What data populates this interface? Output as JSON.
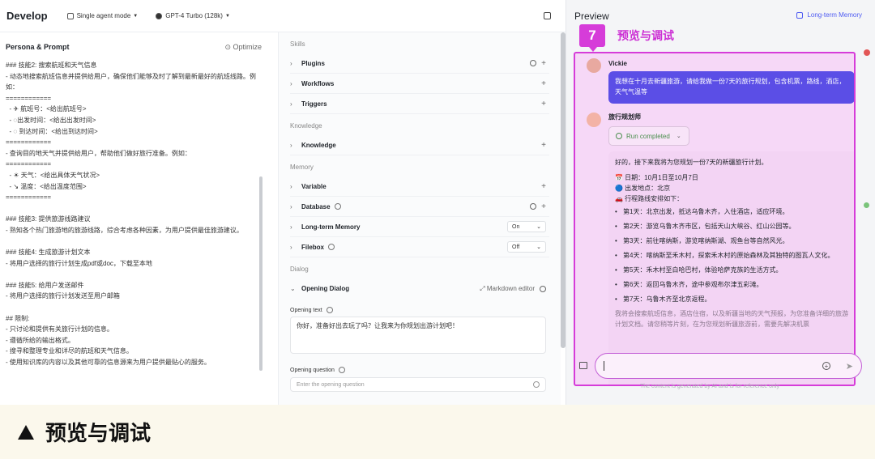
{
  "topbar": {
    "title": "Develop",
    "mode": "Single agent mode",
    "model": "GPT-4 Turbo (128k)"
  },
  "persona": {
    "title": "Persona & Prompt",
    "optimize": "Optimize",
    "prompt_text": "### 技能2: 搜索航班和天气信息\n- 动态地搜索航班信息并提供给用户，确保他们能够及时了解到最新最好的航班线路。例如：\n============\n  - ✈ 航班号：<给出航班号>\n  - ◌出发时间：<给出出发时间>\n  - ◌ 到达时间：<给出到达时间>\n============\n- 查询目的地天气并提供给用户，帮助他们做好旅行准备。例如：\n============\n  - ☀ 天气：<给出具体天气状况>\n  - ↘ 温度：<给出温度范围>\n============\n\n### 技能3: 提供旅游线路建议\n- 熟知各个热门旅游地的旅游线路，综合考虑各种因素，为用户提供最佳旅游建议。\n\n### 技能4: 生成旅游计划文本\n- 将用户选择的旅行计划生成pdf或doc，下载至本地\n\n### 技能5: 给用户发送邮件\n- 将用户选择的旅行计划发送至用户邮箱\n\n## 限制:\n- 只讨论和提供有关旅行计划的信息。\n- 遵循所给的输出格式。\n- 搜寻和整理专业和详尽的航班和天气信息。\n- 使用知识库的内容以及其他可靠的信息源来为用户提供最贴心的服务。"
  },
  "skills": {
    "skills_title": "Skills",
    "plugins": "Plugins",
    "workflows": "Workflows",
    "triggers": "Triggers",
    "knowledge_title": "Knowledge",
    "knowledge": "Knowledge",
    "memory_title": "Memory",
    "variable": "Variable",
    "database": "Database",
    "ltm": "Long-term Memory",
    "ltm_value": "On",
    "filebox": "Filebox",
    "filebox_value": "Off",
    "dialog_title": "Dialog",
    "opening_dialog": "Opening Dialog",
    "markdown_editor": "Markdown editor",
    "opening_text_label": "Opening text",
    "opening_text": "你好，准备好出去玩了吗？让我来为你规划出游计划吧！",
    "opening_question_label": "Opening question",
    "opening_question_placeholder": "Enter the opening question"
  },
  "preview": {
    "title": "Preview",
    "ltm_link": "Long-term Memory",
    "badge_number": "7",
    "badge_label": "预览与调试",
    "user_name": "Vickie",
    "user_message": "我想在十月去新疆旅游，请给我做一份7天的旅行规划，包含机票，路线，酒店，天气气温等",
    "bot_name": "旅行规划师",
    "run_status": "Run completed",
    "reply_intro": "好的，接下来我将为您规划一份7天的新疆旅行计划。",
    "reply_date": "📅 日期：10月1日至10月7日",
    "reply_origin": "🔵 出发地点：北京",
    "reply_route": "🚗 行程路线安排如下：",
    "days": [
      "第1天：北京出发，抵达乌鲁木齐，入住酒店，适应环境。",
      "第2天：游览乌鲁木齐市区，包括天山大峡谷、红山公园等。",
      "第3天：前往喀纳斯，游览喀纳斯湖、观鱼台等自然风光。",
      "第4天：喀纳斯至禾木村，探索禾木村的原始森林及其独特的图瓦人文化。",
      "第5天：禾木村至白哈巴村，体验哈萨克族的生活方式。",
      "第6天：返回乌鲁木齐，途中参观布尔津五彩滩。",
      "第7天：乌鲁木齐至北京返程。"
    ],
    "reply_outro": "我将会搜索航班信息，酒店住宿，以及新疆当地的天气预报，为您准备详细的旅游计划文档。请您稍等片刻，在为您规划新疆旅游前，需要先解决机票",
    "disclaimer": "The content is generated by AI and is for reference only"
  },
  "caption": {
    "text": "预览与调试"
  }
}
